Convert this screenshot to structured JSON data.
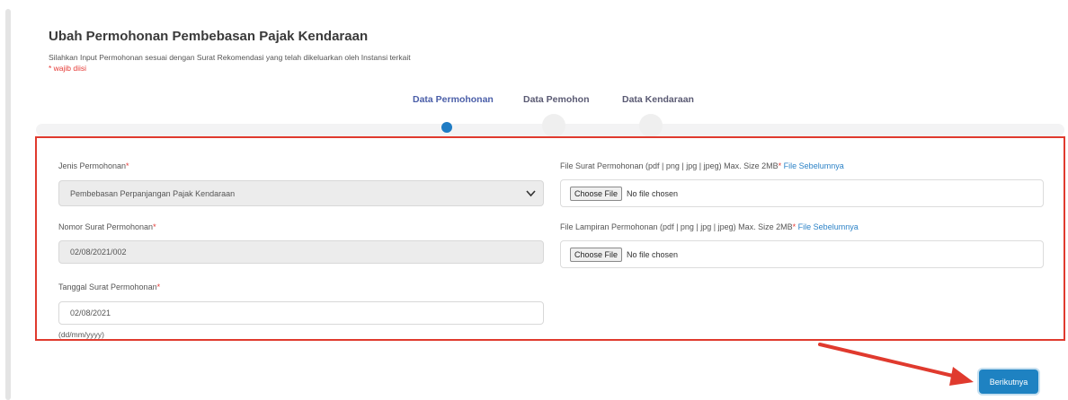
{
  "page": {
    "title": "Ubah Permohonan Pembebasan Pajak Kendaraan",
    "subtitle": "Silahkan Input Permohonan sesuai dengan Surat Rekomendasi yang telah dikeluarkan oleh Instansi terkait",
    "required_note": "* wajib diisi"
  },
  "steps": [
    {
      "label": "Data Permohonan",
      "state": "active"
    },
    {
      "label": "Data Pemohon",
      "state": "inactive"
    },
    {
      "label": "Data Kendaraan",
      "state": "inactive"
    }
  ],
  "form": {
    "jenis": {
      "label": "Jenis Permohonan",
      "star": "*",
      "value": "Pembebasan Perpanjangan Pajak Kendaraan"
    },
    "nomor": {
      "label": "Nomor Surat Permohonan",
      "star": "*",
      "value": "02/08/2021/002"
    },
    "tanggal": {
      "label": "Tanggal Surat Permohonan",
      "star": "*",
      "value": "02/08/2021",
      "hint": "(dd/mm/yyyy)"
    },
    "file_surat": {
      "label": "File Surat Permohonan (pdf | png | jpg | jpeg) Max. Size 2MB",
      "star": "*",
      "link": "File Sebelumnya",
      "button": "Choose File",
      "status": "No file chosen"
    },
    "file_lampiran": {
      "label": "File Lampiran Permohonan (pdf | png | jpg | jpeg) Max. Size 2MB",
      "star": "*",
      "link": "File Sebelumnya",
      "button": "Choose File",
      "status": "No file chosen"
    }
  },
  "actions": {
    "next": "Berikutnya"
  },
  "colors": {
    "accent": "#1e82c2",
    "annotation_red": "#e03a2e",
    "required": "#e53935"
  }
}
